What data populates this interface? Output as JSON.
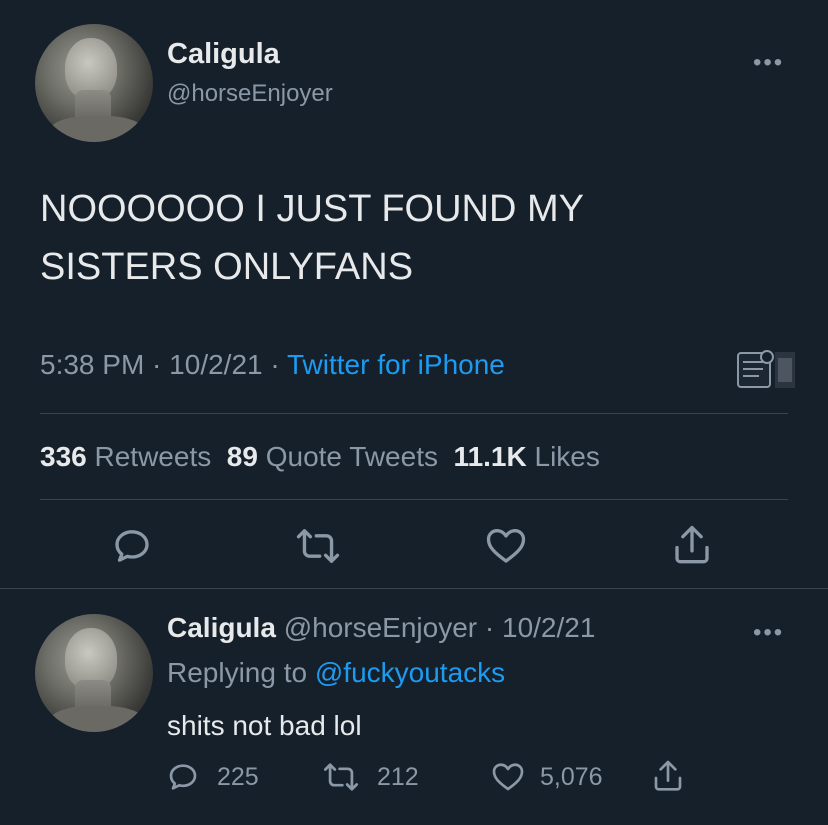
{
  "tweet": {
    "author_name": "Caligula",
    "author_handle": "@horseEnjoyer",
    "more_label": "•••",
    "text_line1": "NOOOOOO I JUST FOUND MY",
    "text_line2": "SISTERS ONLYFANS",
    "time": "5:38 PM",
    "sep1": " · ",
    "date": "10/2/21",
    "sep2": " · ",
    "source": "Twitter for iPhone",
    "stats": {
      "retweets_count": "336",
      "retweets_label": "Retweets",
      "quotes_count": "89",
      "quotes_label": "Quote Tweets",
      "likes_count": "11.1K",
      "likes_label": "Likes"
    },
    "actions": [
      "reply-icon",
      "retweet-icon",
      "like-icon",
      "share-icon"
    ]
  },
  "reply": {
    "author_name": "Caligula",
    "author_handle": "@horseEnjoyer",
    "sep": " · ",
    "date": "10/2/21",
    "more_label": "•••",
    "replying_prefix": "Replying to",
    "replying_to": "@fuckyoutacks",
    "text": "shits not bad lol",
    "reply_count": "225",
    "retweet_count": "212",
    "like_count": "5,076"
  },
  "colors": {
    "background": "#15202b",
    "text": "#e7e9ea",
    "secondary": "#8b98a5",
    "accent": "#1d9bf0",
    "divider": "#38444d"
  }
}
